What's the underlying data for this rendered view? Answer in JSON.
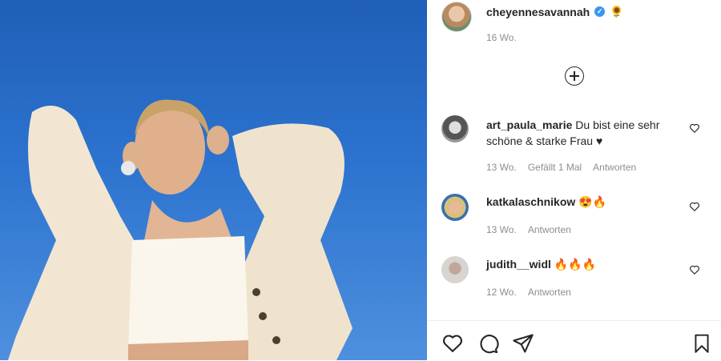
{
  "post": {
    "author": "cheyennesavannah",
    "author_emoji": "🌻",
    "time": "16 Wo."
  },
  "comments": [
    {
      "user": "art_paula_marie",
      "text_line1": "Du bist eine sehr",
      "text_line2": "schöne & starke Frau ♥",
      "time": "13 Wo.",
      "likes": "Gefällt 1 Mal",
      "reply": "Antworten"
    },
    {
      "user": "katkalaschnikow",
      "text": "😍🔥",
      "time": "13 Wo.",
      "reply": "Antworten"
    },
    {
      "user": "judith__widl",
      "text": "🔥🔥🔥",
      "time": "12 Wo.",
      "reply": "Antworten"
    }
  ],
  "icons": {
    "verified": "verified-badge-icon",
    "load_more": "plus-circle-icon",
    "like": "heart-icon",
    "comment": "comment-bubble-icon",
    "share": "paper-plane-icon",
    "save": "bookmark-icon"
  },
  "colors": {
    "verified": "#3897f0",
    "sky": "#2c73cf",
    "muted": "#8e8e8e"
  }
}
